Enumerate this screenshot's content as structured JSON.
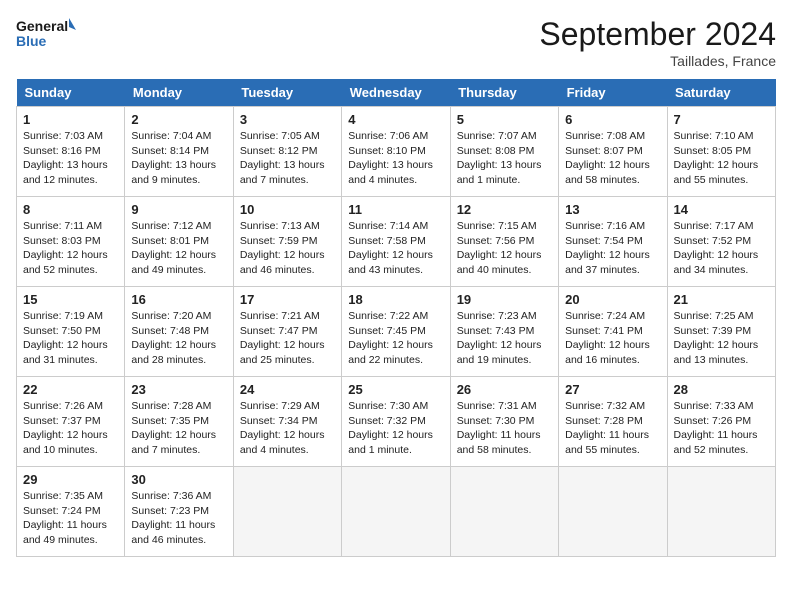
{
  "header": {
    "logo_line1": "General",
    "logo_line2": "Blue",
    "month_title": "September 2024",
    "location": "Taillades, France"
  },
  "days_of_week": [
    "Sunday",
    "Monday",
    "Tuesday",
    "Wednesday",
    "Thursday",
    "Friday",
    "Saturday"
  ],
  "weeks": [
    [
      {
        "day": "1",
        "sunrise": "7:03 AM",
        "sunset": "8:16 PM",
        "daylight": "13 hours and 12 minutes."
      },
      {
        "day": "2",
        "sunrise": "7:04 AM",
        "sunset": "8:14 PM",
        "daylight": "13 hours and 9 minutes."
      },
      {
        "day": "3",
        "sunrise": "7:05 AM",
        "sunset": "8:12 PM",
        "daylight": "13 hours and 7 minutes."
      },
      {
        "day": "4",
        "sunrise": "7:06 AM",
        "sunset": "8:10 PM",
        "daylight": "13 hours and 4 minutes."
      },
      {
        "day": "5",
        "sunrise": "7:07 AM",
        "sunset": "8:08 PM",
        "daylight": "13 hours and 1 minute."
      },
      {
        "day": "6",
        "sunrise": "7:08 AM",
        "sunset": "8:07 PM",
        "daylight": "12 hours and 58 minutes."
      },
      {
        "day": "7",
        "sunrise": "7:10 AM",
        "sunset": "8:05 PM",
        "daylight": "12 hours and 55 minutes."
      }
    ],
    [
      {
        "day": "8",
        "sunrise": "7:11 AM",
        "sunset": "8:03 PM",
        "daylight": "12 hours and 52 minutes."
      },
      {
        "day": "9",
        "sunrise": "7:12 AM",
        "sunset": "8:01 PM",
        "daylight": "12 hours and 49 minutes."
      },
      {
        "day": "10",
        "sunrise": "7:13 AM",
        "sunset": "7:59 PM",
        "daylight": "12 hours and 46 minutes."
      },
      {
        "day": "11",
        "sunrise": "7:14 AM",
        "sunset": "7:58 PM",
        "daylight": "12 hours and 43 minutes."
      },
      {
        "day": "12",
        "sunrise": "7:15 AM",
        "sunset": "7:56 PM",
        "daylight": "12 hours and 40 minutes."
      },
      {
        "day": "13",
        "sunrise": "7:16 AM",
        "sunset": "7:54 PM",
        "daylight": "12 hours and 37 minutes."
      },
      {
        "day": "14",
        "sunrise": "7:17 AM",
        "sunset": "7:52 PM",
        "daylight": "12 hours and 34 minutes."
      }
    ],
    [
      {
        "day": "15",
        "sunrise": "7:19 AM",
        "sunset": "7:50 PM",
        "daylight": "12 hours and 31 minutes."
      },
      {
        "day": "16",
        "sunrise": "7:20 AM",
        "sunset": "7:48 PM",
        "daylight": "12 hours and 28 minutes."
      },
      {
        "day": "17",
        "sunrise": "7:21 AM",
        "sunset": "7:47 PM",
        "daylight": "12 hours and 25 minutes."
      },
      {
        "day": "18",
        "sunrise": "7:22 AM",
        "sunset": "7:45 PM",
        "daylight": "12 hours and 22 minutes."
      },
      {
        "day": "19",
        "sunrise": "7:23 AM",
        "sunset": "7:43 PM",
        "daylight": "12 hours and 19 minutes."
      },
      {
        "day": "20",
        "sunrise": "7:24 AM",
        "sunset": "7:41 PM",
        "daylight": "12 hours and 16 minutes."
      },
      {
        "day": "21",
        "sunrise": "7:25 AM",
        "sunset": "7:39 PM",
        "daylight": "12 hours and 13 minutes."
      }
    ],
    [
      {
        "day": "22",
        "sunrise": "7:26 AM",
        "sunset": "7:37 PM",
        "daylight": "12 hours and 10 minutes."
      },
      {
        "day": "23",
        "sunrise": "7:28 AM",
        "sunset": "7:35 PM",
        "daylight": "12 hours and 7 minutes."
      },
      {
        "day": "24",
        "sunrise": "7:29 AM",
        "sunset": "7:34 PM",
        "daylight": "12 hours and 4 minutes."
      },
      {
        "day": "25",
        "sunrise": "7:30 AM",
        "sunset": "7:32 PM",
        "daylight": "12 hours and 1 minute."
      },
      {
        "day": "26",
        "sunrise": "7:31 AM",
        "sunset": "7:30 PM",
        "daylight": "11 hours and 58 minutes."
      },
      {
        "day": "27",
        "sunrise": "7:32 AM",
        "sunset": "7:28 PM",
        "daylight": "11 hours and 55 minutes."
      },
      {
        "day": "28",
        "sunrise": "7:33 AM",
        "sunset": "7:26 PM",
        "daylight": "11 hours and 52 minutes."
      }
    ],
    [
      {
        "day": "29",
        "sunrise": "7:35 AM",
        "sunset": "7:24 PM",
        "daylight": "11 hours and 49 minutes."
      },
      {
        "day": "30",
        "sunrise": "7:36 AM",
        "sunset": "7:23 PM",
        "daylight": "11 hours and 46 minutes."
      },
      null,
      null,
      null,
      null,
      null
    ]
  ]
}
